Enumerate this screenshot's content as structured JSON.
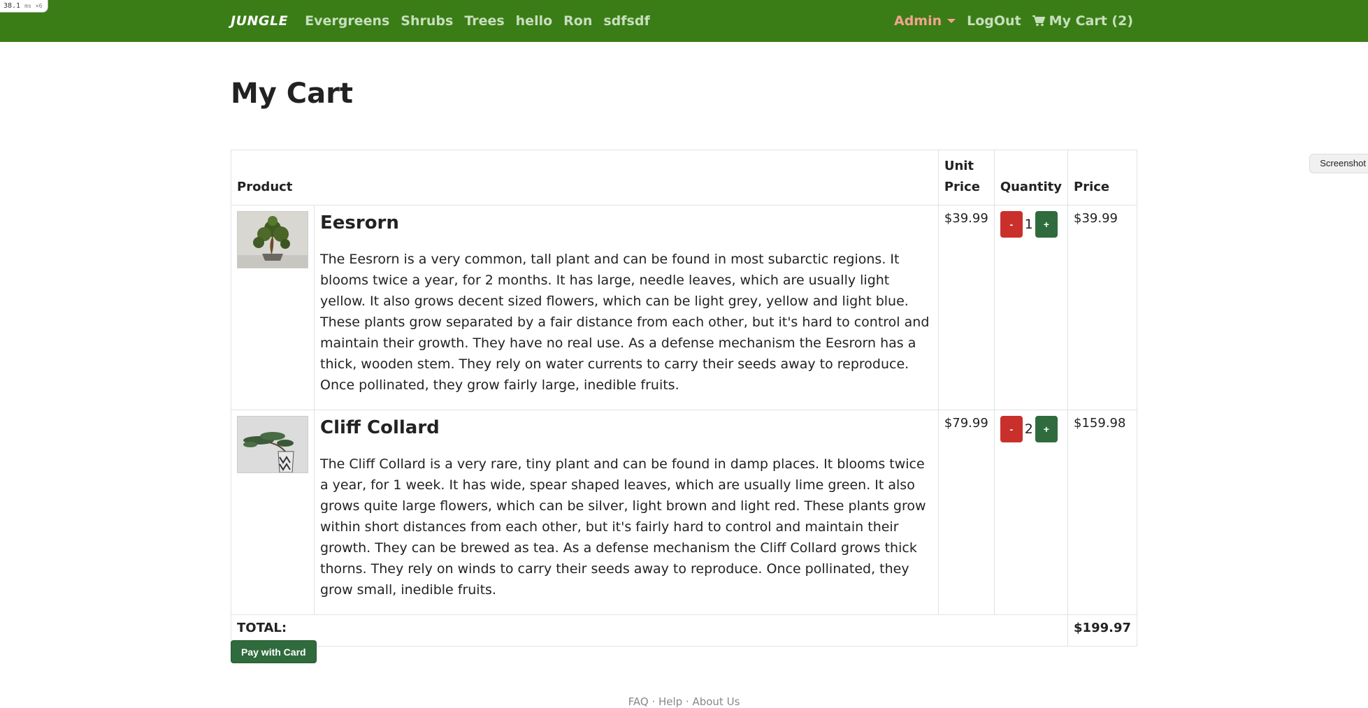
{
  "perf_badge": {
    "value": "38.1",
    "unit": "ms",
    "suffix": "×6"
  },
  "nav": {
    "brand": "JUNGLE",
    "links": [
      "Evergreens",
      "Shrubs",
      "Trees",
      "hello",
      "Ron",
      "sdfsdf"
    ],
    "admin": "Admin",
    "logout": "LogOut",
    "cart": "My Cart (2)",
    "colors": {
      "bar": "#3a7d16",
      "link": "#c8dfbe",
      "admin": "#f4a38f"
    }
  },
  "page": {
    "title": "My Cart"
  },
  "table": {
    "headers": {
      "product": "Product",
      "unit_price": "Unit Price",
      "quantity": "Quantity",
      "price": "Price"
    },
    "items": [
      {
        "name": "Eesrorn",
        "description": "The Eesrorn is a very common, tall plant and can be found in most subarctic regions. It blooms twice a year, for 2 months. It has large, needle leaves, which are usually light yellow. It also grows decent sized flowers, which can be light grey, yellow and light blue. These plants grow separated by a fair distance from each other, but it's hard to control and maintain their growth. They have no real use. As a defense mechanism the Eesrorn has a thick, wooden stem. They rely on water currents to carry their seeds away to reproduce. Once pollinated, they grow fairly large, inedible fruits.",
        "unit_price": "$39.99",
        "quantity": "1",
        "price": "$39.99",
        "minus": "-",
        "plus": "+"
      },
      {
        "name": "Cliff Collard",
        "description": "The Cliff Collard is a very rare, tiny plant and can be found in damp places. It blooms twice a year, for 1 week. It has wide, spear shaped leaves, which are usually lime green. It also grows quite large flowers, which can be silver, light brown and light red. These plants grow within short distances from each other, but it's fairly hard to control and maintain their growth. They can be brewed as tea. As a defense mechanism the Cliff Collard grows thick thorns. They rely on winds to carry their seeds away to reproduce. Once pollinated, they grow small, inedible fruits.",
        "unit_price": "$79.99",
        "quantity": "2",
        "price": "$159.98",
        "minus": "-",
        "plus": "+"
      }
    ],
    "total_label": "TOTAL:",
    "total_value": "$199.97"
  },
  "pay_button": "Pay with Card",
  "screenshot_tab": "Screenshot",
  "footer": "FAQ  ·  Help  ·  About Us"
}
